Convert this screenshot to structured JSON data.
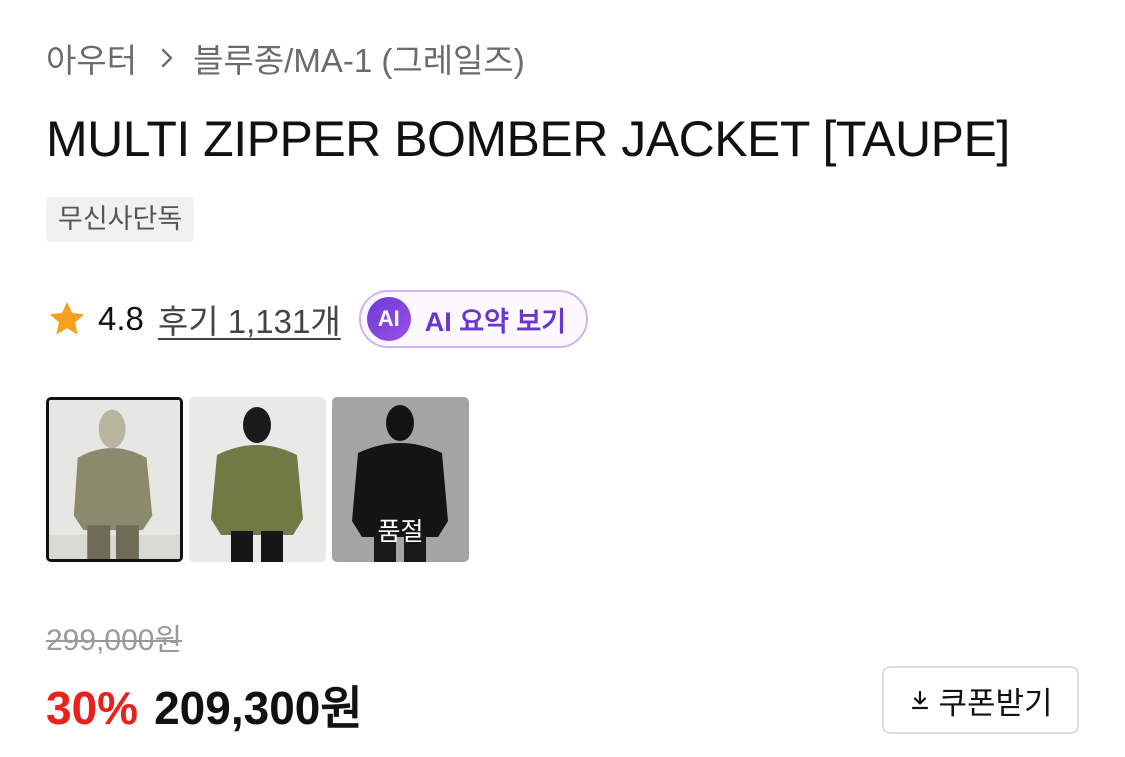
{
  "breadcrumb": {
    "category": "아우터",
    "subcategory": "블루종/MA-1 (그레일즈)",
    "separator_icon": "chevron-right-icon"
  },
  "product": {
    "title": "MULTI ZIPPER BOMBER JACKET [TAUPE]",
    "badge": "무신사단독"
  },
  "rating": {
    "icon": "star-icon",
    "star_color": "#f7a01d",
    "value": "4.8",
    "review_link": "후기 1,131개"
  },
  "ai_summary": {
    "badge": "AI",
    "label": "AI 요약 보기",
    "accent_color": "#6a35cf"
  },
  "thumbnails": [
    {
      "color_name": "taupe",
      "selected": true,
      "sold_out": false,
      "sold_out_label": ""
    },
    {
      "color_name": "khaki",
      "selected": false,
      "sold_out": false,
      "sold_out_label": ""
    },
    {
      "color_name": "black",
      "selected": false,
      "sold_out": true,
      "sold_out_label": "품절"
    }
  ],
  "price": {
    "original": "299,000원",
    "discount": "30%",
    "discount_color": "#e8221b",
    "sale": "209,300원"
  },
  "coupon": {
    "icon": "download-icon",
    "label": "쿠폰받기"
  }
}
